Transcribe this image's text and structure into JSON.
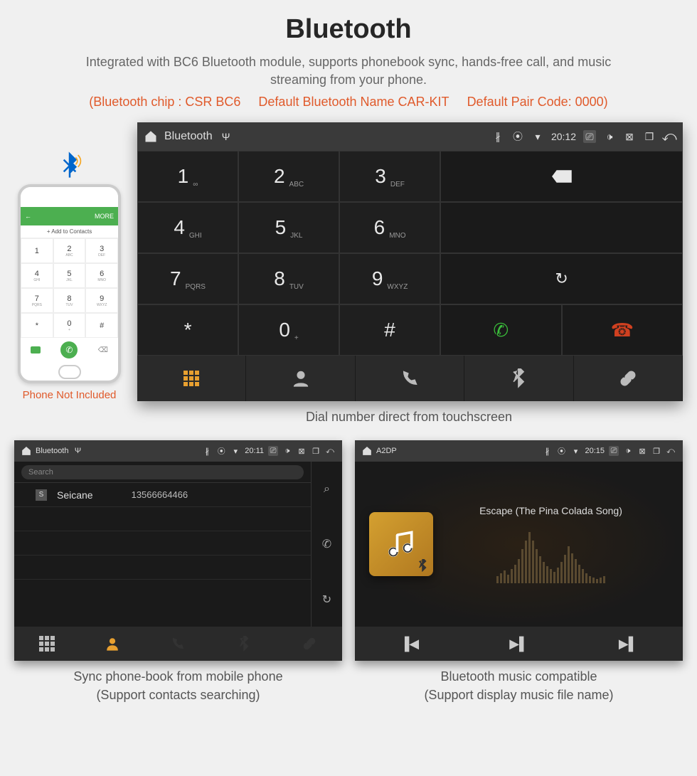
{
  "heading": "Bluetooth",
  "subtitle": "Integrated with BC6 Bluetooth module, supports phonebook sync, hands-free call, and music streaming from your phone.",
  "spec": {
    "chip": "(Bluetooth chip : CSR BC6",
    "name": "Default Bluetooth Name CAR-KIT",
    "code": "Default Pair Code: 0000)"
  },
  "phone_mock": {
    "note": "Phone Not Included",
    "add_label": "Add to Contacts",
    "more": "MORE",
    "keys": [
      {
        "d": "1",
        "s": ""
      },
      {
        "d": "2",
        "s": "ABC"
      },
      {
        "d": "3",
        "s": "DEF"
      },
      {
        "d": "4",
        "s": "GHI"
      },
      {
        "d": "5",
        "s": "JKL"
      },
      {
        "d": "6",
        "s": "MNO"
      },
      {
        "d": "7",
        "s": "PQRS"
      },
      {
        "d": "8",
        "s": "TUV"
      },
      {
        "d": "9",
        "s": "WXYZ"
      },
      {
        "d": "*",
        "s": ""
      },
      {
        "d": "0",
        "s": "+"
      },
      {
        "d": "#",
        "s": ""
      }
    ]
  },
  "dialer": {
    "status": {
      "title": "Bluetooth",
      "time": "20:12"
    },
    "keys": {
      "1": "1",
      "1s": "∞",
      "2": "2",
      "2s": "ABC",
      "3": "3",
      "3s": "DEF",
      "4": "4",
      "4s": "GHI",
      "5": "5",
      "5s": "JKL",
      "6": "6",
      "6s": "MNO",
      "7": "7",
      "7s": "PQRS",
      "8": "8",
      "8s": "TUV",
      "9": "9",
      "9s": "WXYZ",
      "star": "*",
      "0": "0",
      "0s": "+",
      "hash": "#"
    },
    "caption": "Dial number direct from touchscreen"
  },
  "contacts": {
    "status": {
      "title": "Bluetooth",
      "time": "20:11"
    },
    "search_placeholder": "Search",
    "entry_badge": "S",
    "entry_name": "Seicane",
    "entry_number": "13566664466",
    "caption_l1": "Sync phone-book from mobile phone",
    "caption_l2": "(Support contacts searching)"
  },
  "music": {
    "status": {
      "title": "A2DP",
      "time": "20:15"
    },
    "track": "Escape (The Pina Colada Song)",
    "caption_l1": "Bluetooth music compatible",
    "caption_l2": "(Support display music file name)"
  }
}
